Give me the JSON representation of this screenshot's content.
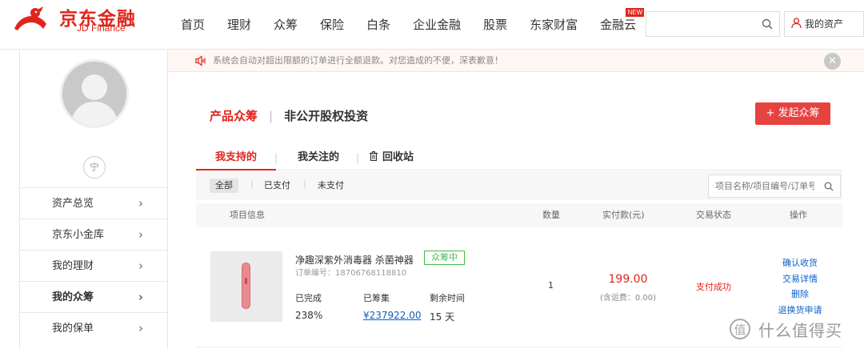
{
  "header": {
    "brand_cn": "京东金融",
    "brand_en": "JD Finance",
    "nav": [
      {
        "label": "首页"
      },
      {
        "label": "理财"
      },
      {
        "label": "众筹"
      },
      {
        "label": "保险"
      },
      {
        "label": "白条"
      },
      {
        "label": "企业金融"
      },
      {
        "label": "股票"
      },
      {
        "label": "东家财富"
      },
      {
        "label": "金融云",
        "badge": "NEW"
      }
    ],
    "search_placeholder": "",
    "my_assets": "我的资产"
  },
  "sidebar": {
    "level": "宁",
    "items": [
      {
        "label": "资产总览",
        "active": false
      },
      {
        "label": "京东小金库",
        "active": false
      },
      {
        "label": "我的理财",
        "active": false
      },
      {
        "label": "我的众筹",
        "active": true
      },
      {
        "label": "我的保单",
        "active": false
      }
    ]
  },
  "notice": {
    "text": "系统会自动对超出限额的订单进行全额退款。对您造成的不便，深表歉意！"
  },
  "page": {
    "title_active": "产品众筹",
    "title_other": "非公开股权投资",
    "launch_button": "发起众筹"
  },
  "tabs": [
    {
      "label": "我支持的",
      "active": true
    },
    {
      "label": "我关注的",
      "active": false
    },
    {
      "label": "回收站",
      "active": false
    }
  ],
  "filters": [
    {
      "label": "全部",
      "active": true
    },
    {
      "label": "已支付",
      "active": false
    },
    {
      "label": "未支付",
      "active": false
    }
  ],
  "order_search_placeholder": "项目名称/项目编号/订单号",
  "table": {
    "headers": [
      "项目信息",
      "数量",
      "实付款(元)",
      "交易状态",
      "操作"
    ]
  },
  "order": {
    "name": "净趣深紫外消毒器 杀菌神器",
    "badge": "众筹中",
    "order_no": "订单编号：18706768118810",
    "completed_label": "已完成",
    "completed_value": "238%",
    "raised_label": "已筹集",
    "raised_value": "¥237922.00",
    "remaining_label": "剩余时间",
    "remaining_value": "15 天",
    "quantity": "1",
    "price": "199.00",
    "shipping": "(含运费：0.00)",
    "status": "支付成功",
    "actions": [
      "确认收货",
      "交易详情",
      "删除",
      "退换货申请"
    ]
  },
  "watermark": {
    "text": "什么值得买"
  },
  "colors": {
    "brand_red": "#e1251b",
    "button_red": "#e64340",
    "link_blue": "#0b5ec9",
    "badge_green": "#43b84d"
  }
}
